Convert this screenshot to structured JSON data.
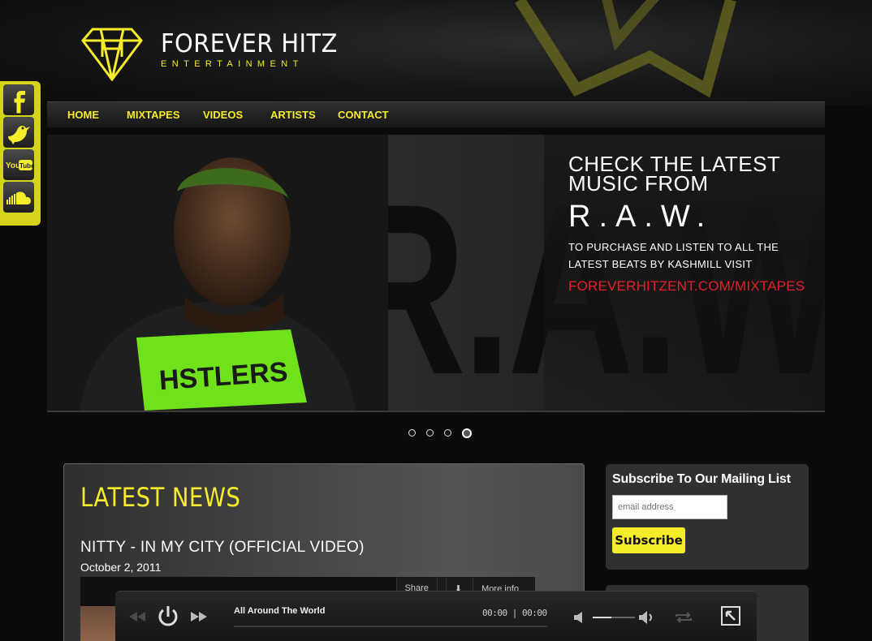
{
  "brand": {
    "title_main": "FOREVER ",
    "title_accent": "HITZ",
    "subtitle": "ENTERTAINMENT",
    "accent_color": "#f5ec2a"
  },
  "social": [
    {
      "name": "facebook-icon"
    },
    {
      "name": "twitter-bird-icon"
    },
    {
      "name": "youtube-icon"
    },
    {
      "name": "soundcloud-icon"
    }
  ],
  "nav": {
    "items": [
      "HOME",
      "MIXTAPES",
      "VIDEOS",
      "ARTISTS",
      "CONTACT"
    ]
  },
  "slider": {
    "background_text": "R.A.W.",
    "caption_line1": "CHECK THE LATEST",
    "caption_line2": "MUSIC FROM",
    "artist": "R.A.W.",
    "small_line1": "TO PURCHASE AND LISTEN TO ALL THE",
    "small_line2": "LATEST BEATS BY KASHMILL VISIT",
    "url": "FOREVERHITZENT.COM/MIXTAPES",
    "slide_count": 4,
    "active_slide": 4
  },
  "news": {
    "heading": "LATEST NEWS",
    "post_title": "NITTY - IN MY CITY (OFFICIAL VIDEO)",
    "post_date": "October 2, 2011",
    "video_share": "Share",
    "video_more": "More info"
  },
  "subscribe": {
    "title": "Subscribe To Our Mailing List",
    "placeholder": "email address",
    "button": "Subscribe"
  },
  "player": {
    "track": "All Around The World",
    "time_current": "00:00",
    "time_total": "00:00",
    "volume": 0.45
  }
}
